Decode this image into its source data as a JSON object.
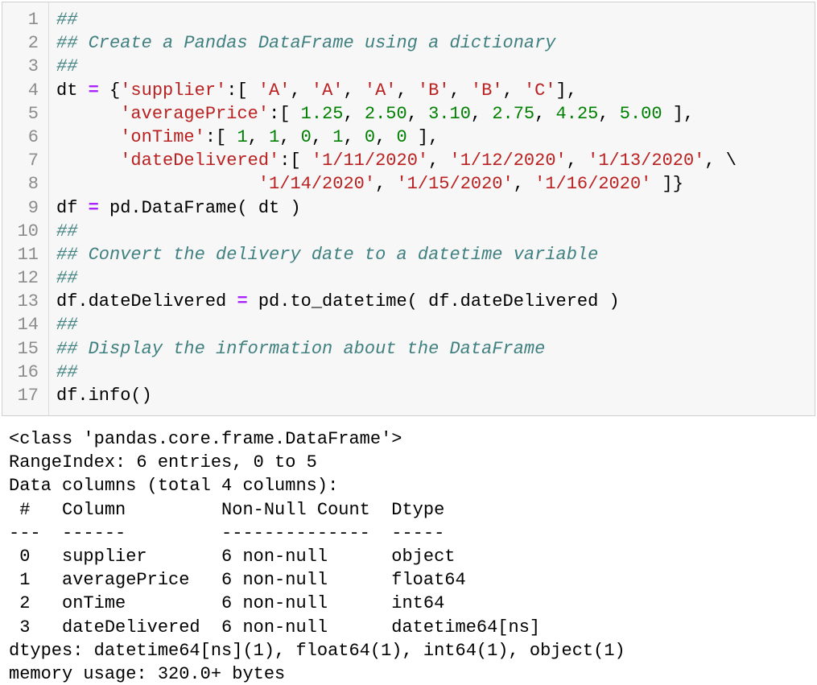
{
  "code_cell": {
    "lines": [
      {
        "n": "1",
        "tokens": [
          {
            "t": "##",
            "c": "comment"
          }
        ]
      },
      {
        "n": "2",
        "tokens": [
          {
            "t": "## Create a Pandas DataFrame using a dictionary",
            "c": "comment"
          }
        ]
      },
      {
        "n": "3",
        "tokens": [
          {
            "t": "##",
            "c": "comment"
          }
        ]
      },
      {
        "n": "4",
        "tokens": [
          {
            "t": "dt ",
            "c": "plain"
          },
          {
            "t": "=",
            "c": "op"
          },
          {
            "t": " {",
            "c": "plain"
          },
          {
            "t": "'supplier'",
            "c": "str"
          },
          {
            "t": ":[ ",
            "c": "plain"
          },
          {
            "t": "'A'",
            "c": "str"
          },
          {
            "t": ", ",
            "c": "plain"
          },
          {
            "t": "'A'",
            "c": "str"
          },
          {
            "t": ", ",
            "c": "plain"
          },
          {
            "t": "'A'",
            "c": "str"
          },
          {
            "t": ", ",
            "c": "plain"
          },
          {
            "t": "'B'",
            "c": "str"
          },
          {
            "t": ", ",
            "c": "plain"
          },
          {
            "t": "'B'",
            "c": "str"
          },
          {
            "t": ", ",
            "c": "plain"
          },
          {
            "t": "'C'",
            "c": "str"
          },
          {
            "t": "],",
            "c": "plain"
          }
        ]
      },
      {
        "n": "5",
        "tokens": [
          {
            "t": "      ",
            "c": "plain"
          },
          {
            "t": "'averagePrice'",
            "c": "str"
          },
          {
            "t": ":[ ",
            "c": "plain"
          },
          {
            "t": "1.25",
            "c": "num"
          },
          {
            "t": ", ",
            "c": "plain"
          },
          {
            "t": "2.50",
            "c": "num"
          },
          {
            "t": ", ",
            "c": "plain"
          },
          {
            "t": "3.10",
            "c": "num"
          },
          {
            "t": ", ",
            "c": "plain"
          },
          {
            "t": "2.75",
            "c": "num"
          },
          {
            "t": ", ",
            "c": "plain"
          },
          {
            "t": "4.25",
            "c": "num"
          },
          {
            "t": ", ",
            "c": "plain"
          },
          {
            "t": "5.00",
            "c": "num"
          },
          {
            "t": " ],",
            "c": "plain"
          }
        ]
      },
      {
        "n": "6",
        "tokens": [
          {
            "t": "      ",
            "c": "plain"
          },
          {
            "t": "'onTime'",
            "c": "str"
          },
          {
            "t": ":[ ",
            "c": "plain"
          },
          {
            "t": "1",
            "c": "num"
          },
          {
            "t": ", ",
            "c": "plain"
          },
          {
            "t": "1",
            "c": "num"
          },
          {
            "t": ", ",
            "c": "plain"
          },
          {
            "t": "0",
            "c": "num"
          },
          {
            "t": ", ",
            "c": "plain"
          },
          {
            "t": "1",
            "c": "num"
          },
          {
            "t": ", ",
            "c": "plain"
          },
          {
            "t": "0",
            "c": "num"
          },
          {
            "t": ", ",
            "c": "plain"
          },
          {
            "t": "0",
            "c": "num"
          },
          {
            "t": " ],",
            "c": "plain"
          }
        ]
      },
      {
        "n": "7",
        "tokens": [
          {
            "t": "      ",
            "c": "plain"
          },
          {
            "t": "'dateDelivered'",
            "c": "str"
          },
          {
            "t": ":[ ",
            "c": "plain"
          },
          {
            "t": "'1/11/2020'",
            "c": "str"
          },
          {
            "t": ", ",
            "c": "plain"
          },
          {
            "t": "'1/12/2020'",
            "c": "str"
          },
          {
            "t": ", ",
            "c": "plain"
          },
          {
            "t": "'1/13/2020'",
            "c": "str"
          },
          {
            "t": ", \\",
            "c": "plain"
          }
        ]
      },
      {
        "n": "8",
        "tokens": [
          {
            "t": "                   ",
            "c": "plain"
          },
          {
            "t": "'1/14/2020'",
            "c": "str"
          },
          {
            "t": ", ",
            "c": "plain"
          },
          {
            "t": "'1/15/2020'",
            "c": "str"
          },
          {
            "t": ", ",
            "c": "plain"
          },
          {
            "t": "'1/16/2020'",
            "c": "str"
          },
          {
            "t": " ]}",
            "c": "plain"
          }
        ]
      },
      {
        "n": "9",
        "tokens": [
          {
            "t": "df ",
            "c": "plain"
          },
          {
            "t": "=",
            "c": "op"
          },
          {
            "t": " pd.DataFrame( dt )",
            "c": "plain"
          }
        ]
      },
      {
        "n": "10",
        "tokens": [
          {
            "t": "##",
            "c": "comment"
          }
        ]
      },
      {
        "n": "11",
        "tokens": [
          {
            "t": "## Convert the delivery date to a datetime variable",
            "c": "comment"
          }
        ]
      },
      {
        "n": "12",
        "tokens": [
          {
            "t": "##",
            "c": "comment"
          }
        ]
      },
      {
        "n": "13",
        "tokens": [
          {
            "t": "df.dateDelivered ",
            "c": "plain"
          },
          {
            "t": "=",
            "c": "op"
          },
          {
            "t": " pd.to_datetime( df.dateDelivered )",
            "c": "plain"
          }
        ]
      },
      {
        "n": "14",
        "tokens": [
          {
            "t": "##",
            "c": "comment"
          }
        ]
      },
      {
        "n": "15",
        "tokens": [
          {
            "t": "## Display the information about the DataFrame",
            "c": "comment"
          }
        ]
      },
      {
        "n": "16",
        "tokens": [
          {
            "t": "##",
            "c": "comment"
          }
        ]
      },
      {
        "n": "17",
        "tokens": [
          {
            "t": "df.info()",
            "c": "plain"
          }
        ]
      }
    ]
  },
  "output": {
    "lines": [
      "<class 'pandas.core.frame.DataFrame'>",
      "RangeIndex: 6 entries, 0 to 5",
      "Data columns (total 4 columns):",
      " #   Column         Non-Null Count  Dtype",
      "---  ------         --------------  -----",
      " 0   supplier       6 non-null      object",
      " 1   averagePrice   6 non-null      float64",
      " 2   onTime         6 non-null      int64",
      " 3   dateDelivered  6 non-null      datetime64[ns]",
      "dtypes: datetime64[ns](1), float64(1), int64(1), object(1)",
      "memory usage: 320.0+ bytes"
    ]
  },
  "colors": {
    "comment": "#408080",
    "string": "#ba2121",
    "number": "#008000",
    "operator": "#aa22ff",
    "line_number": "#8c8c8c",
    "cell_background": "#f7f7f7",
    "cell_border": "#cfcfcf"
  }
}
